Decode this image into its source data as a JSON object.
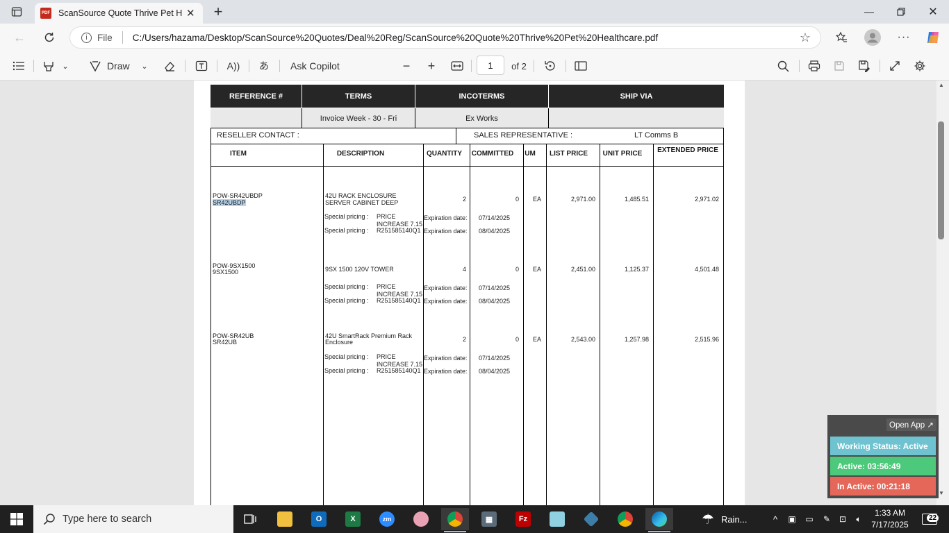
{
  "browser": {
    "tab_title": "ScanSource Quote Thrive Pet Hea",
    "protocol_label": "File",
    "url": "C:/Users/hazama/Desktop/ScanSource%20Quotes/Deal%20Reg/ScanSource%20Quote%20Thrive%20Pet%20Healthcare.pdf"
  },
  "pdf_toolbar": {
    "draw_label": "Draw",
    "ask_copilot_label": "Ask Copilot",
    "current_page": "1",
    "page_total": "of 2"
  },
  "document": {
    "header_cols": [
      "REFERENCE #",
      "TERMS",
      "INCOTERMS",
      "SHIP VIA"
    ],
    "header_vals": [
      "",
      "Invoice Week - 30 - Fri",
      "Ex Works",
      ""
    ],
    "reseller_contact_label": "RESELLER CONTACT :",
    "sales_rep_label": "SALES REPRESENTATIVE :",
    "sales_rep_value": "LT Comms B",
    "columns": [
      "ITEM",
      "DESCRIPTION",
      "QUANTITY",
      "COMMITTED",
      "UM",
      "LIST PRICE",
      "UNIT PRICE",
      "EXTENDED PRICE"
    ],
    "items": [
      {
        "item_line1": "POW-SR42UBDP",
        "item_line2": "SR42UBDP",
        "desc_line1": "42U RACK ENCLOSURE",
        "desc_line2": "SERVER CABINET DEEP",
        "quantity": "2",
        "committed": "0",
        "um": "EA",
        "list_price": "2,971.00",
        "unit_price": "1,485.51",
        "extended_price": "2,971.02",
        "sp_label": "Special pricing :",
        "sp1_line1": "PRICE",
        "sp1_line2": "INCREASE 7.15",
        "sp2": "R251585140Q1",
        "exp_label": "Expiration date:",
        "exp1": "07/14/2025",
        "exp2": "08/04/2025"
      },
      {
        "item_line1": "POW-9SX1500",
        "item_line2": "9SX1500",
        "desc_line1": "9SX 1500 120V TOWER",
        "desc_line2": "",
        "quantity": "4",
        "committed": "0",
        "um": "EA",
        "list_price": "2,451.00",
        "unit_price": "1,125.37",
        "extended_price": "4,501.48",
        "sp_label": "Special pricing :",
        "sp1_line1": "PRICE",
        "sp1_line2": "INCREASE 7.15",
        "sp2": "R251585140Q1",
        "exp_label": "Expiration date:",
        "exp1": "07/14/2025",
        "exp2": "08/04/2025"
      },
      {
        "item_line1": "POW-SR42UB",
        "item_line2": "SR42UB",
        "desc_line1": "42U SmartRack Premium Rack",
        "desc_line2": "Enclosure",
        "quantity": "2",
        "committed": "0",
        "um": "EA",
        "list_price": "2,543.00",
        "unit_price": "1,257.98",
        "extended_price": "2,515.96",
        "sp_label": "Special pricing :",
        "sp1_line1": "PRICE",
        "sp1_line2": "INCREASE 7.15",
        "sp2": "R251585140Q1",
        "exp_label": "Expiration date:",
        "exp1": "07/14/2025",
        "exp2": "08/04/2025"
      }
    ]
  },
  "widget": {
    "open_app_label": "Open App ↗",
    "status": "Working Status: Active",
    "active": "Active: 03:56:49",
    "inactive": "In Active: 00:21:18",
    "colors": {
      "status": "#6fc3d0",
      "active": "#4cc97a",
      "inactive": "#e5675a"
    }
  },
  "taskbar": {
    "search_placeholder": "Type here to search",
    "weather_label": "Rain...",
    "time": "1:33 AM",
    "date": "7/17/2025",
    "notification_count": "22"
  },
  "icons": {
    "tab_list": "tab-list-icon",
    "pdf": "pdf-icon",
    "copilot": "copilot-icon"
  }
}
